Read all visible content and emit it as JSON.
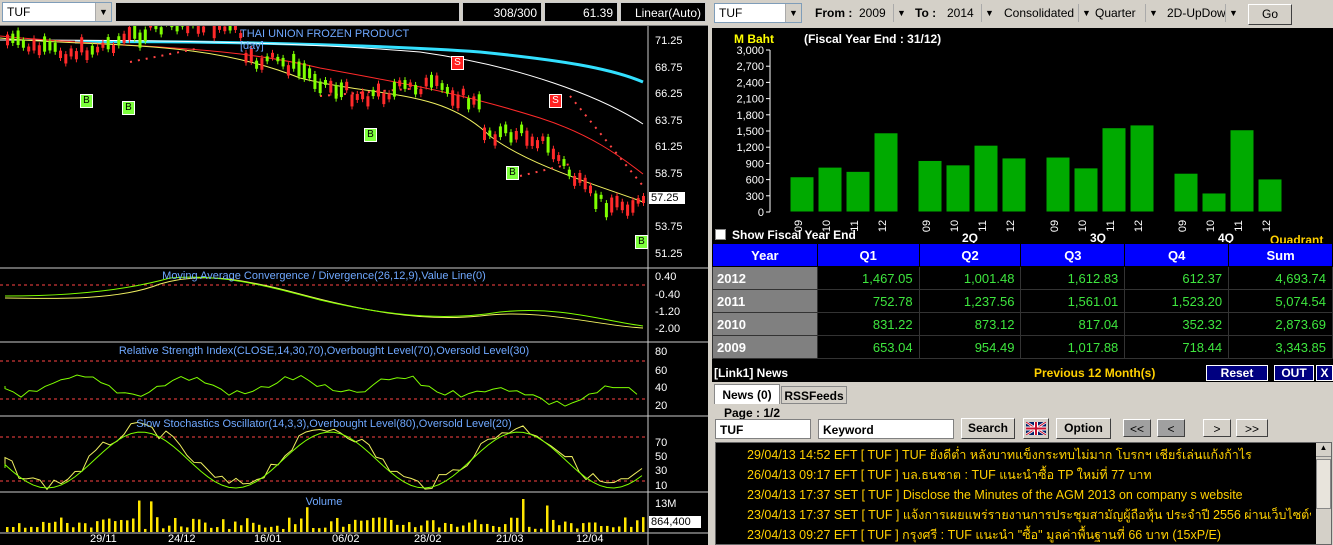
{
  "left": {
    "symbol": "TUF",
    "count": "308/300",
    "price_box": "61.39",
    "scale": "Linear(Auto)",
    "chart_title": "THAI UNION FROZEN PRODUCT [day]",
    "price_axis": [
      "71.25",
      "68.75",
      "66.25",
      "63.75",
      "61.25",
      "58.75",
      "57.25",
      "53.75",
      "51.25"
    ],
    "last_price": "57.25",
    "signals": [
      {
        "label": "B"
      },
      {
        "label": "B"
      },
      {
        "label": "B"
      },
      {
        "label": "S"
      },
      {
        "label": "S"
      },
      {
        "label": "B"
      },
      {
        "label": "B"
      }
    ],
    "macd_title": "Moving Average Convergence / Divergence(26,12,9),Value Line(0)",
    "macd_axis": [
      "0.40",
      "-0.40",
      "-1.20",
      "-2.00"
    ],
    "rsi_title": "Relative Strength Index(CLOSE,14,30,70),Overbought Level(70),Oversold Level(30)",
    "rsi_axis": [
      "80",
      "60",
      "40",
      "20"
    ],
    "stoch_title": "Slow Stochastics Oscillator(14,3,3),Overbought Level(80),Oversold Level(20)",
    "stoch_axis": [
      "70",
      "50",
      "30",
      "10"
    ],
    "volume_title": "Volume",
    "volume_axis": [
      "13M"
    ],
    "last_volume": "864,400",
    "dates": [
      "29/11",
      "24/12",
      "16/01",
      "06/02",
      "28/02",
      "21/03",
      "12/04"
    ]
  },
  "right": {
    "symbol": "TUF",
    "from_label": "From :",
    "from_value": "2009",
    "to_label": "To :",
    "to_value": "2014",
    "type_value": "Consolidated",
    "period_value": "Quarter",
    "view_value": "2D-UpDown",
    "go_label": "Go",
    "unit_label": "M Baht",
    "fiscal_label": "(Fiscal Year End : 31/12)",
    "show_fiscal": "Show Fiscal Year End",
    "quadrant_label": "Quadrant",
    "chart_data": {
      "type": "bar",
      "title": "(Fiscal Year End : 31/12)",
      "ylabel": "M Baht",
      "ylim": [
        0,
        3000
      ],
      "yticks": [
        "3,000",
        "2,700",
        "2,400",
        "2,100",
        "1,800",
        "1,500",
        "1,200",
        "900",
        "600",
        "300",
        "0"
      ],
      "groups": [
        "1Q",
        "2Q",
        "3Q",
        "4Q"
      ],
      "group_labels": [
        "",
        "2Q",
        "3Q",
        "4Q"
      ],
      "categories": [
        "09",
        "10",
        "11",
        "12"
      ],
      "series": [
        {
          "values": [
            653.04,
            831.22,
            752.78,
            1467.05
          ]
        },
        {
          "values": [
            954.49,
            873.12,
            1237.56,
            1001.48
          ]
        },
        {
          "values": [
            1017.88,
            817.04,
            1561.01,
            1612.83
          ]
        },
        {
          "values": [
            718.44,
            352.32,
            1523.2,
            612.37
          ]
        }
      ],
      "bar_color": "#00aa00"
    },
    "table": {
      "headers": [
        "Year",
        "Q1",
        "Q2",
        "Q3",
        "Q4",
        "Sum"
      ],
      "rows": [
        [
          "2012",
          "1,467.05",
          "1,001.48",
          "1,612.83",
          "612.37",
          "4,693.74"
        ],
        [
          "2011",
          "752.78",
          "1,237.56",
          "1,561.01",
          "1,523.20",
          "5,074.54"
        ],
        [
          "2010",
          "831.22",
          "873.12",
          "817.04",
          "352.32",
          "2,873.69"
        ],
        [
          "2009",
          "653.04",
          "954.49",
          "1,017.88",
          "718.44",
          "3,343.85"
        ]
      ]
    },
    "news": {
      "title": "[Link1] News",
      "period": "Previous 12 Month(s)",
      "reset": "Reset",
      "out": "OUT",
      "close": "X",
      "tab_news": "News (0)",
      "tab_rss": "RSSFeeds",
      "page": "Page : 1/2",
      "symbol": "TUF",
      "keyword": "Keyword",
      "search": "Search",
      "option": "Option",
      "nav": [
        "<<",
        "<",
        ">",
        ">>"
      ],
      "items": [
        "29/04/13 14:52  EFT  [ TUF ]  TUF ยังดีต่ำ หลังบาทแข็งกระทบไม่มาก โบรกฯ เชียร์เล่นแก้งก้าไร",
        "26/04/13 09:17  EFT  [ TUF ]  บล.ธนชาต : TUF แนะนำซื้อ TP ใหม่ที่ 77 บาท",
        "23/04/13 17:37  SET  [ TUF ]  Disclose the Minutes of the AGM 2013 on company s website",
        "23/04/13 17:37  SET  [ TUF ]  แจ้งการเผยแพร่รายงานการประชุมสามัญผู้ถือหุ้น ประจำปี 2556 ผ่านเว็บไซต์ของบ...",
        "23/04/13 09:27  EFT  [ TUF ]  กรุงศรี : TUF แนะนำ \"ซื้อ\" มูลค่าพื้นฐานที่ 66 บาท (15xP/E)"
      ]
    }
  }
}
